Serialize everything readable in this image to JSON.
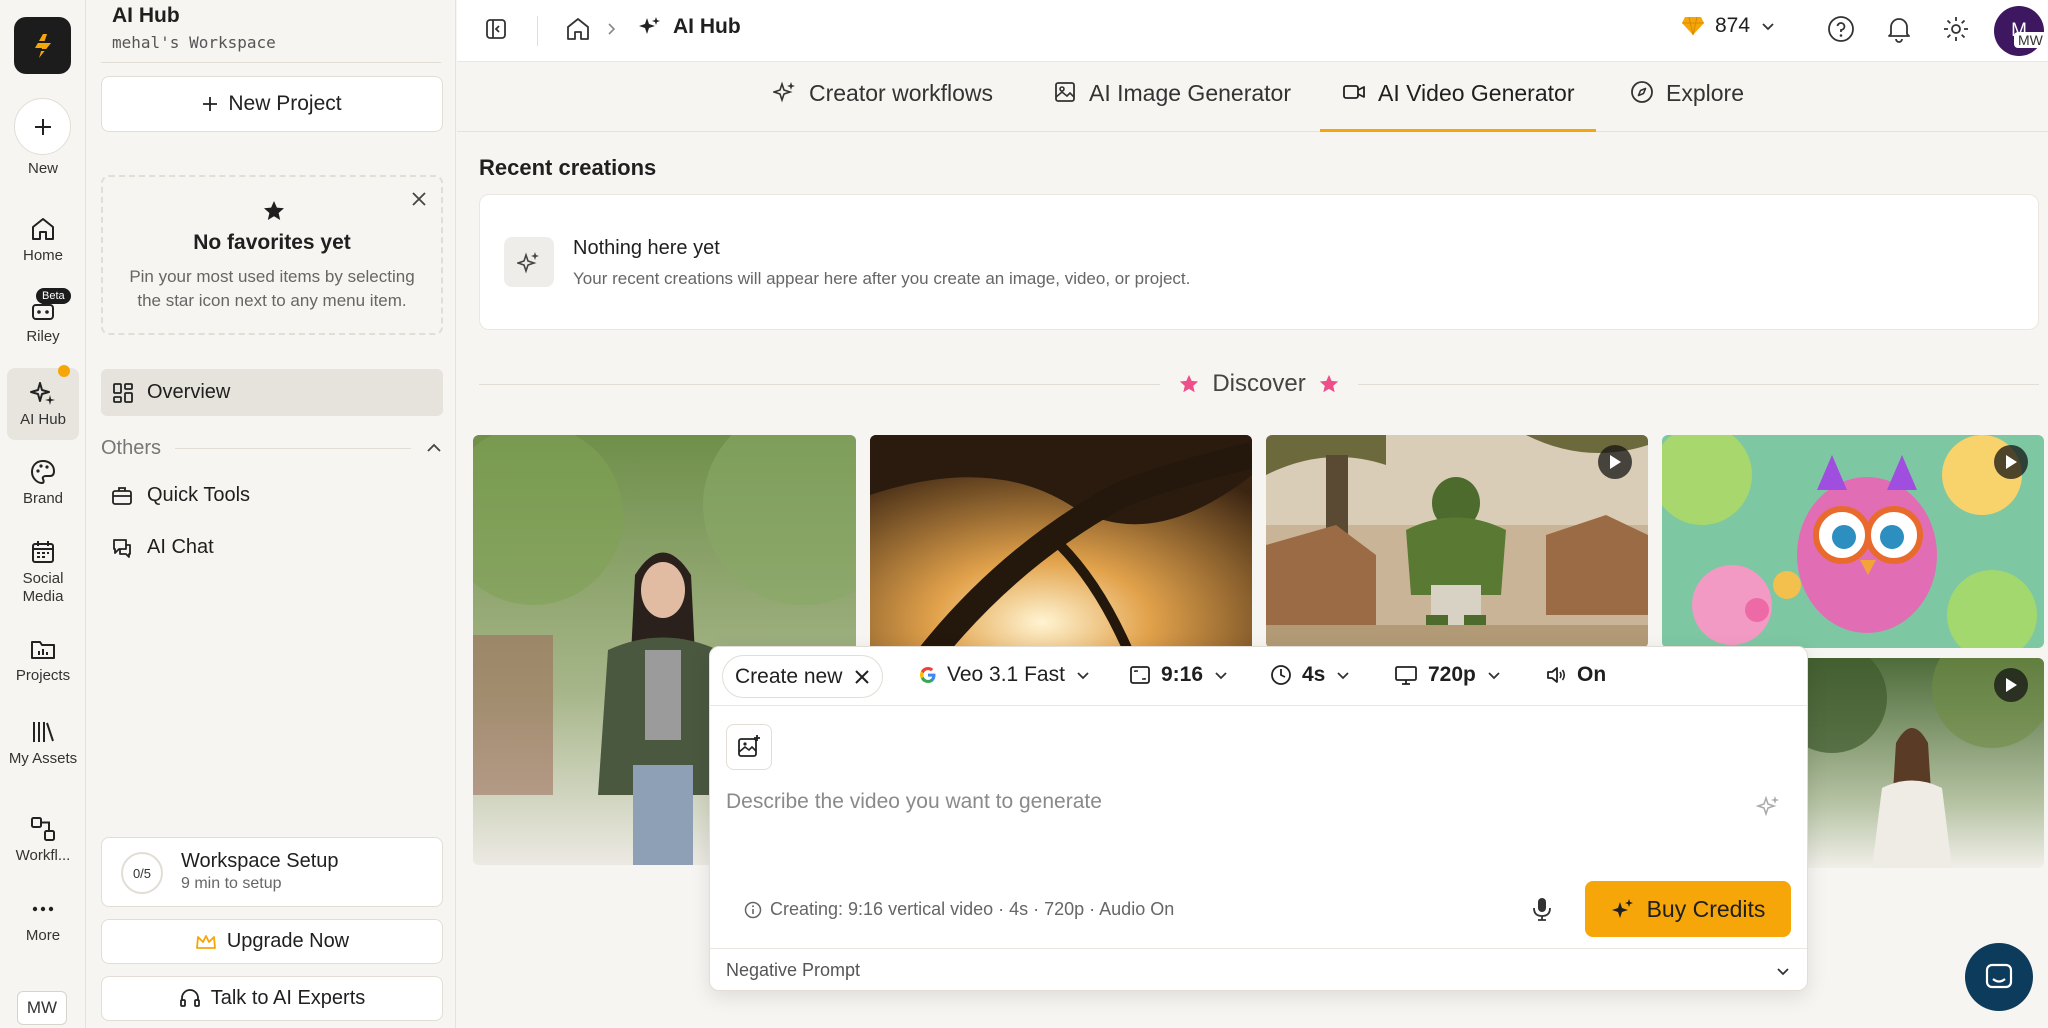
{
  "app": {
    "accent": "#f6a609",
    "brand_dark": "#1c1c1c"
  },
  "rail": {
    "new_label": "New",
    "items": [
      {
        "label": "Home",
        "icon": "home-icon"
      },
      {
        "label": "Riley",
        "icon": "robot-icon",
        "badge": "Beta"
      },
      {
        "label": "AI Hub",
        "icon": "sparkles-icon",
        "active": true
      },
      {
        "label": "Brand",
        "icon": "palette-icon"
      },
      {
        "label": "Social Media",
        "icon": "calendar-icon"
      },
      {
        "label": "Projects",
        "icon": "folder-chart-icon"
      },
      {
        "label": "My Assets",
        "icon": "library-icon"
      },
      {
        "label": "Workfl...",
        "icon": "workflow-icon"
      },
      {
        "label": "More",
        "icon": "more-icon"
      }
    ],
    "user_initials": "MW"
  },
  "sidebar": {
    "title": "AI Hub",
    "workspace": "mehal's Workspace",
    "new_project": "New Project",
    "favorites": {
      "title": "No favorites yet",
      "desc": "Pin your most used items by selecting the star icon next to any menu item."
    },
    "overview": "Overview",
    "others": "Others",
    "links": [
      "Quick Tools",
      "AI Chat"
    ],
    "setup": {
      "progress": "0/5",
      "title": "Workspace Setup",
      "sub": "9 min to setup"
    },
    "upgrade": "Upgrade Now",
    "experts": "Talk to AI Experts"
  },
  "topbar": {
    "breadcrumb": "AI Hub",
    "credits": "874",
    "avatar": "M",
    "avatar_tag": "MW"
  },
  "tabs": [
    {
      "label": "Creator workflows",
      "icon": "sparkles-icon"
    },
    {
      "label": "AI Image Generator",
      "icon": "image-icon"
    },
    {
      "label": "AI Video Generator",
      "icon": "video-icon",
      "active": true
    },
    {
      "label": "Explore",
      "icon": "compass-icon"
    }
  ],
  "main": {
    "recent_title": "Recent creations",
    "empty_title": "Nothing here yet",
    "empty_desc": "Your recent creations will appear here after you create an image, video, or project.",
    "discover": "Discover"
  },
  "composer": {
    "mode": "Create new",
    "model": "Veo 3.1 Fast",
    "aspect": "9:16",
    "duration": "4s",
    "resolution": "720p",
    "audio": "On",
    "placeholder": "Describe the video you want to generate",
    "info": "Creating: 9:16 vertical video · 4s · 720p · Audio On",
    "buy": "Buy Credits",
    "negative": "Negative Prompt"
  }
}
